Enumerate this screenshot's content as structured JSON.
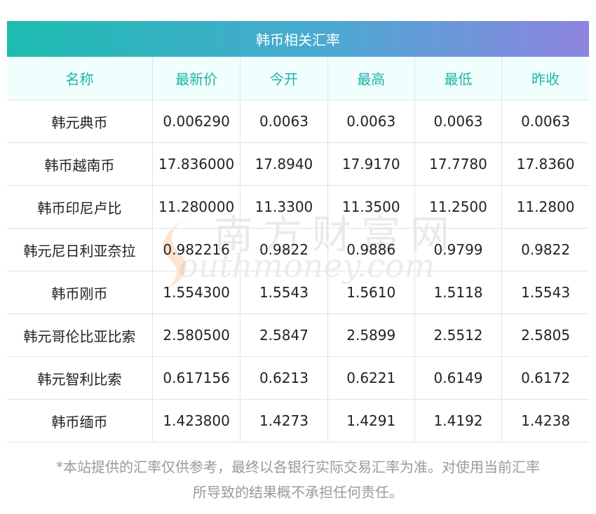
{
  "title": "韩币相关汇率",
  "columns": [
    "名称",
    "最新价",
    "今开",
    "最高",
    "最低",
    "昨收"
  ],
  "rows": [
    [
      "韩元典币",
      "0.006290",
      "0.0063",
      "0.0063",
      "0.0063",
      "0.0063"
    ],
    [
      "韩币越南币",
      "17.836000",
      "17.8940",
      "17.9170",
      "17.7780",
      "17.8360"
    ],
    [
      "韩币印尼卢比",
      "11.280000",
      "11.3300",
      "11.3500",
      "11.2500",
      "11.2800"
    ],
    [
      "韩元尼日利亚奈拉",
      "0.982216",
      "0.9822",
      "0.9886",
      "0.9799",
      "0.9822"
    ],
    [
      "韩币刚币",
      "1.554300",
      "1.5543",
      "1.5610",
      "1.5118",
      "1.5543"
    ],
    [
      "韩元哥伦比亚比索",
      "2.580500",
      "2.5847",
      "2.5899",
      "2.5512",
      "2.5805"
    ],
    [
      "韩元智利比索",
      "0.617156",
      "0.6213",
      "0.6221",
      "0.6149",
      "0.6172"
    ],
    [
      "韩币缅币",
      "1.423800",
      "1.4273",
      "1.4291",
      "1.4192",
      "1.4238"
    ]
  ],
  "watermark": {
    "cn": "南方财富网",
    "en": "outhmoney.com"
  },
  "footnote": {
    "line1": "*本站提供的汇率仅供参考，最终以各银行实际交易汇率为准。对使用当前汇率",
    "line2": "所导致的结果概不承担任何责任。"
  },
  "colors": {
    "header_text": "#1eb3a6",
    "header_bg": "#f0fffd",
    "title_gradient_start": "#1cbcb0",
    "title_gradient_end": "#8e84e0",
    "body_text": "#222222",
    "footnote_text": "#9a9a9a"
  }
}
